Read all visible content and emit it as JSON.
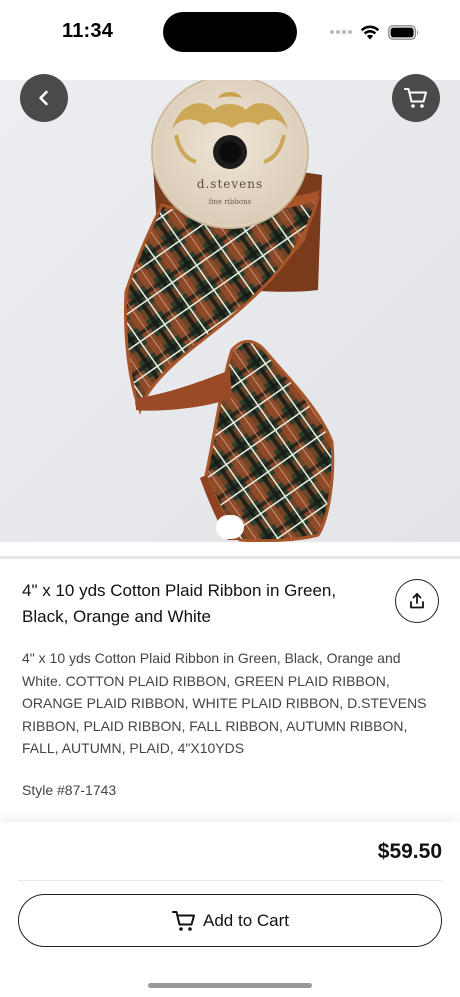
{
  "status_bar": {
    "time": "11:34",
    "icons": [
      "signal-dots-icon",
      "wifi-icon",
      "battery-icon"
    ]
  },
  "hero": {
    "image_description": "Green black orange and white plaid ribbon spool",
    "spool_brand": "d.stevens",
    "spool_tagline": "fine ribbons",
    "page_indicator": {
      "current": 1,
      "total": 1
    }
  },
  "nav": {
    "back_icon": "chevron-left-icon",
    "cart_icon": "cart-icon"
  },
  "product": {
    "title": "4\" x 10 yds Cotton Plaid Ribbon in Green, Black, Orange and White",
    "description": "4\" x 10 yds Cotton Plaid Ribbon in Green, Black, Orange and White. COTTON PLAID RIBBON, GREEN PLAID RIBBON, ORANGE PLAID RIBBON, WHITE PLAID RIBBON, D.STEVENS RIBBON, PLAID RIBBON, FALL RIBBON, AUTUMN RIBBON, FALL, AUTUMN, PLAID, 4\"X10YDS",
    "style_number": "Style #87-1743",
    "share_icon": "share-icon"
  },
  "purchase": {
    "price": "$59.50",
    "add_to_cart_label": "Add to Cart",
    "add_to_cart_icon": "cart-icon"
  },
  "colors": {
    "nav_button_bg": "#4a4a4a",
    "ribbon_green": "#2c3f2c",
    "ribbon_orange": "#a4502a",
    "ribbon_edge": "#b25a2a",
    "spool_cream": "#e8dccb",
    "text_primary": "#111111",
    "text_secondary": "#444444"
  }
}
